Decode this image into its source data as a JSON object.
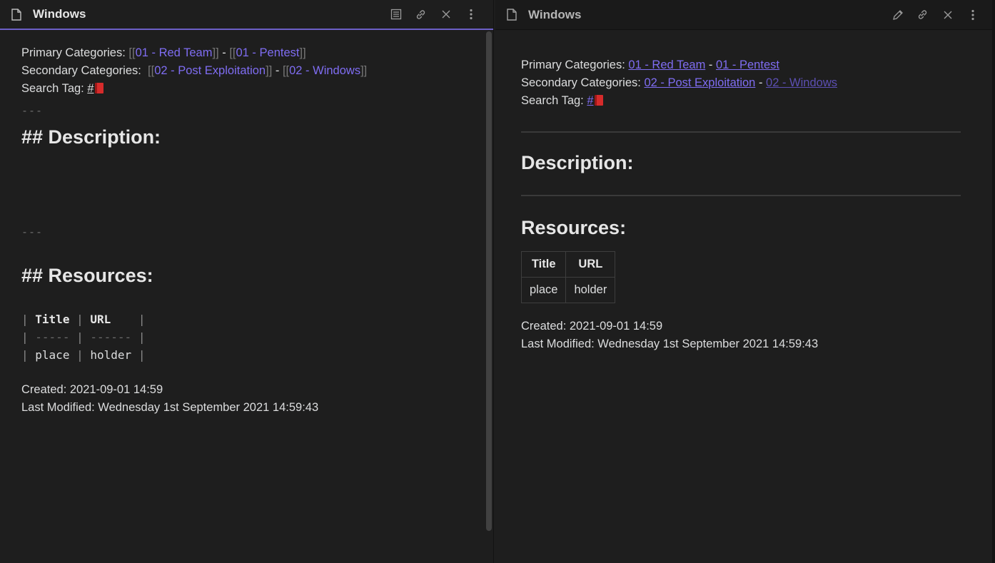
{
  "left": {
    "title": "Windows",
    "icons": [
      "file-icon",
      "reading-view-icon",
      "link-icon",
      "close-icon",
      "more-options-icon"
    ],
    "primary_label": "Primary Categories: ",
    "primary_link1": "01 - Red Team",
    "primary_link2": "01 - Pentest",
    "secondary_label": "Secondary Categories:  ",
    "secondary_link1": "02 - Post Exploitation",
    "secondary_link2": "02 - Windows",
    "search_label": "Search Tag: ",
    "search_hash": "#",
    "hr1": "---",
    "desc_heading": "## Description:",
    "hr2": "---",
    "res_heading": "## Resources:",
    "table_row1_c1": "Title",
    "table_row1_c2": "URL",
    "table_row2_c1": "-----",
    "table_row2_c2": "------",
    "table_row3_c1": "place",
    "table_row3_c2": "holder",
    "created": "Created: 2021-09-01 14:59",
    "modified": "Last Modified: Wednesday 1st September 2021 14:59:43"
  },
  "right": {
    "title": "Windows",
    "icons": [
      "file-icon",
      "edit-icon",
      "link-icon",
      "close-icon",
      "more-options-icon"
    ],
    "primary_label": "Primary Categories: ",
    "primary_link1": "01 - Red Team",
    "primary_link2": "01 - Pentest",
    "secondary_label": "Secondary Categories: ",
    "secondary_link1": "02 - Post Exploitation",
    "secondary_link2": "02 - Windows",
    "search_label": "Search Tag: ",
    "search_hash": "#",
    "separator": " - ",
    "desc_heading": "Description:",
    "res_heading": "Resources:",
    "table": {
      "headers": [
        "Title",
        "URL"
      ],
      "rows": [
        [
          "place",
          "holder"
        ]
      ]
    },
    "created": "Created: 2021-09-01 14:59",
    "modified": "Last Modified: Wednesday 1st September 2021 14:59:43"
  },
  "colors": {
    "accent": "#7f6df2",
    "background": "#1e1e1e",
    "text": "#dcddde"
  }
}
